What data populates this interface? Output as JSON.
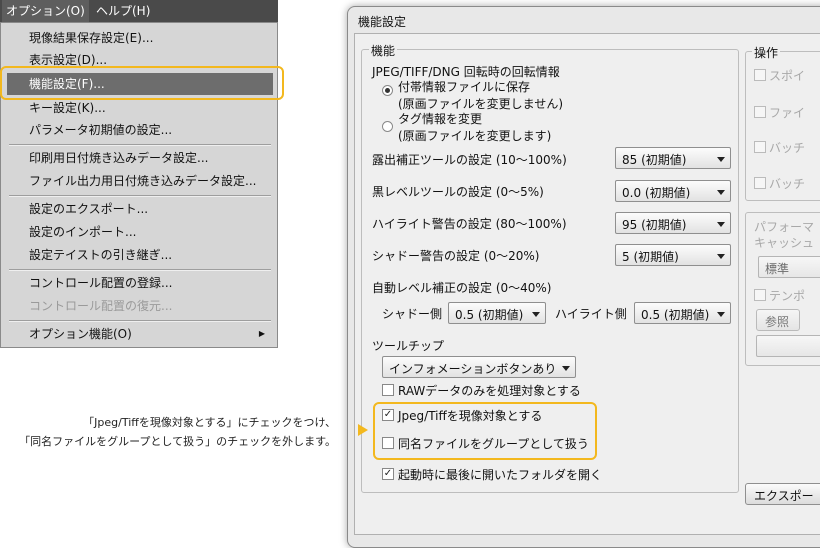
{
  "menubar": {
    "options": "オプション(O)",
    "help": "ヘルプ(H)"
  },
  "menu": {
    "items": [
      "現像結果保存設定(E)...",
      "表示設定(D)...",
      "機能設定(F)...",
      "キー設定(K)...",
      "パラメータ初期値の設定...",
      "印刷用日付焼き込みデータ設定...",
      "ファイル出力用日付焼き込みデータ設定...",
      "設定のエクスポート...",
      "設定のインポート...",
      "設定テイストの引き継ぎ...",
      "コントロール配置の登録...",
      "コントロール配置の復元...",
      "オプション機能(O)"
    ]
  },
  "instruction": {
    "line1": "「Jpeg/Tiffを現像対象とする」にチェックをつけ、",
    "line2": "「同名ファイルをグループとして扱う」のチェックを外します。"
  },
  "dialog": {
    "title": "機能設定",
    "group_label": "機能",
    "rotation_label": "JPEG/TIFF/DNG 回転時の回転情報",
    "radio1_line1": "付帯情報ファイルに保存",
    "radio1_line2": "(原画ファイルを変更しません)",
    "radio2_line1": "タグ情報を変更",
    "radio2_line2": "(原画ファイルを変更します)",
    "exposure_label": "露出補正ツールの設定 (10〜100%)",
    "exposure_value": "85 (初期値)",
    "black_label": "黒レベルツールの設定 (0〜5%)",
    "black_value": "0.0 (初期値)",
    "highlight_label": "ハイライト警告の設定 (80〜100%)",
    "highlight_value": "95 (初期値)",
    "shadow_label": "シャドー警告の設定 (0〜20%)",
    "shadow_value": "5 (初期値)",
    "autolevel_label": "自動レベル補正の設定 (0〜40%)",
    "shadow_side_label": "シャドー側",
    "shadow_side_value": "0.5 (初期値)",
    "highlight_side_label": "ハイライト側",
    "highlight_side_value": "0.5 (初期値)",
    "tooltip_label": "ツールチップ",
    "tooltip_value": "インフォメーションボタンあり",
    "cb_raw_only": "RAWデータのみを処理対象とする",
    "cb_jpeg_tiff": "Jpeg/Tiffを現像対象とする",
    "cb_group": "同名ファイルをグループとして扱う",
    "cb_open_last": "起動時に最後に開いたフォルダを開く",
    "right_group_label": "操作",
    "right_cb1": "スポイ",
    "right_cb2": "ファイ",
    "right_cb3": "バッチ",
    "right_cb4": "バッチ",
    "perf_label": "パフォーマ",
    "cache_label": "キャッシュ",
    "perf_select": "標準",
    "temp_label": "テンポ",
    "ref_button": "参照",
    "export_button": "エクスポー"
  },
  "checkbox_states": {
    "raw_only": false,
    "jpeg_tiff": true,
    "group": false,
    "open_last": true
  },
  "colors": {
    "highlight": "#f3b81e",
    "menu_bar": "#4a4a4a",
    "menu_active": "#6d6d6d"
  }
}
